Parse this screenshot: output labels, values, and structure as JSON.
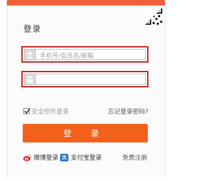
{
  "login": {
    "title": "登录",
    "account_placeholder": "手机号/会员名/邮箱",
    "password_value": "",
    "remember_label": "安全控件登录",
    "forgot_label": "忘记登录密码?",
    "submit_label": "登 录",
    "weibo_label": "微博登录",
    "alipay_label": "支付宝登录",
    "register_label": "免费注册"
  },
  "colors": {
    "accent": "#f2611c",
    "highlight": "#c5271e"
  }
}
